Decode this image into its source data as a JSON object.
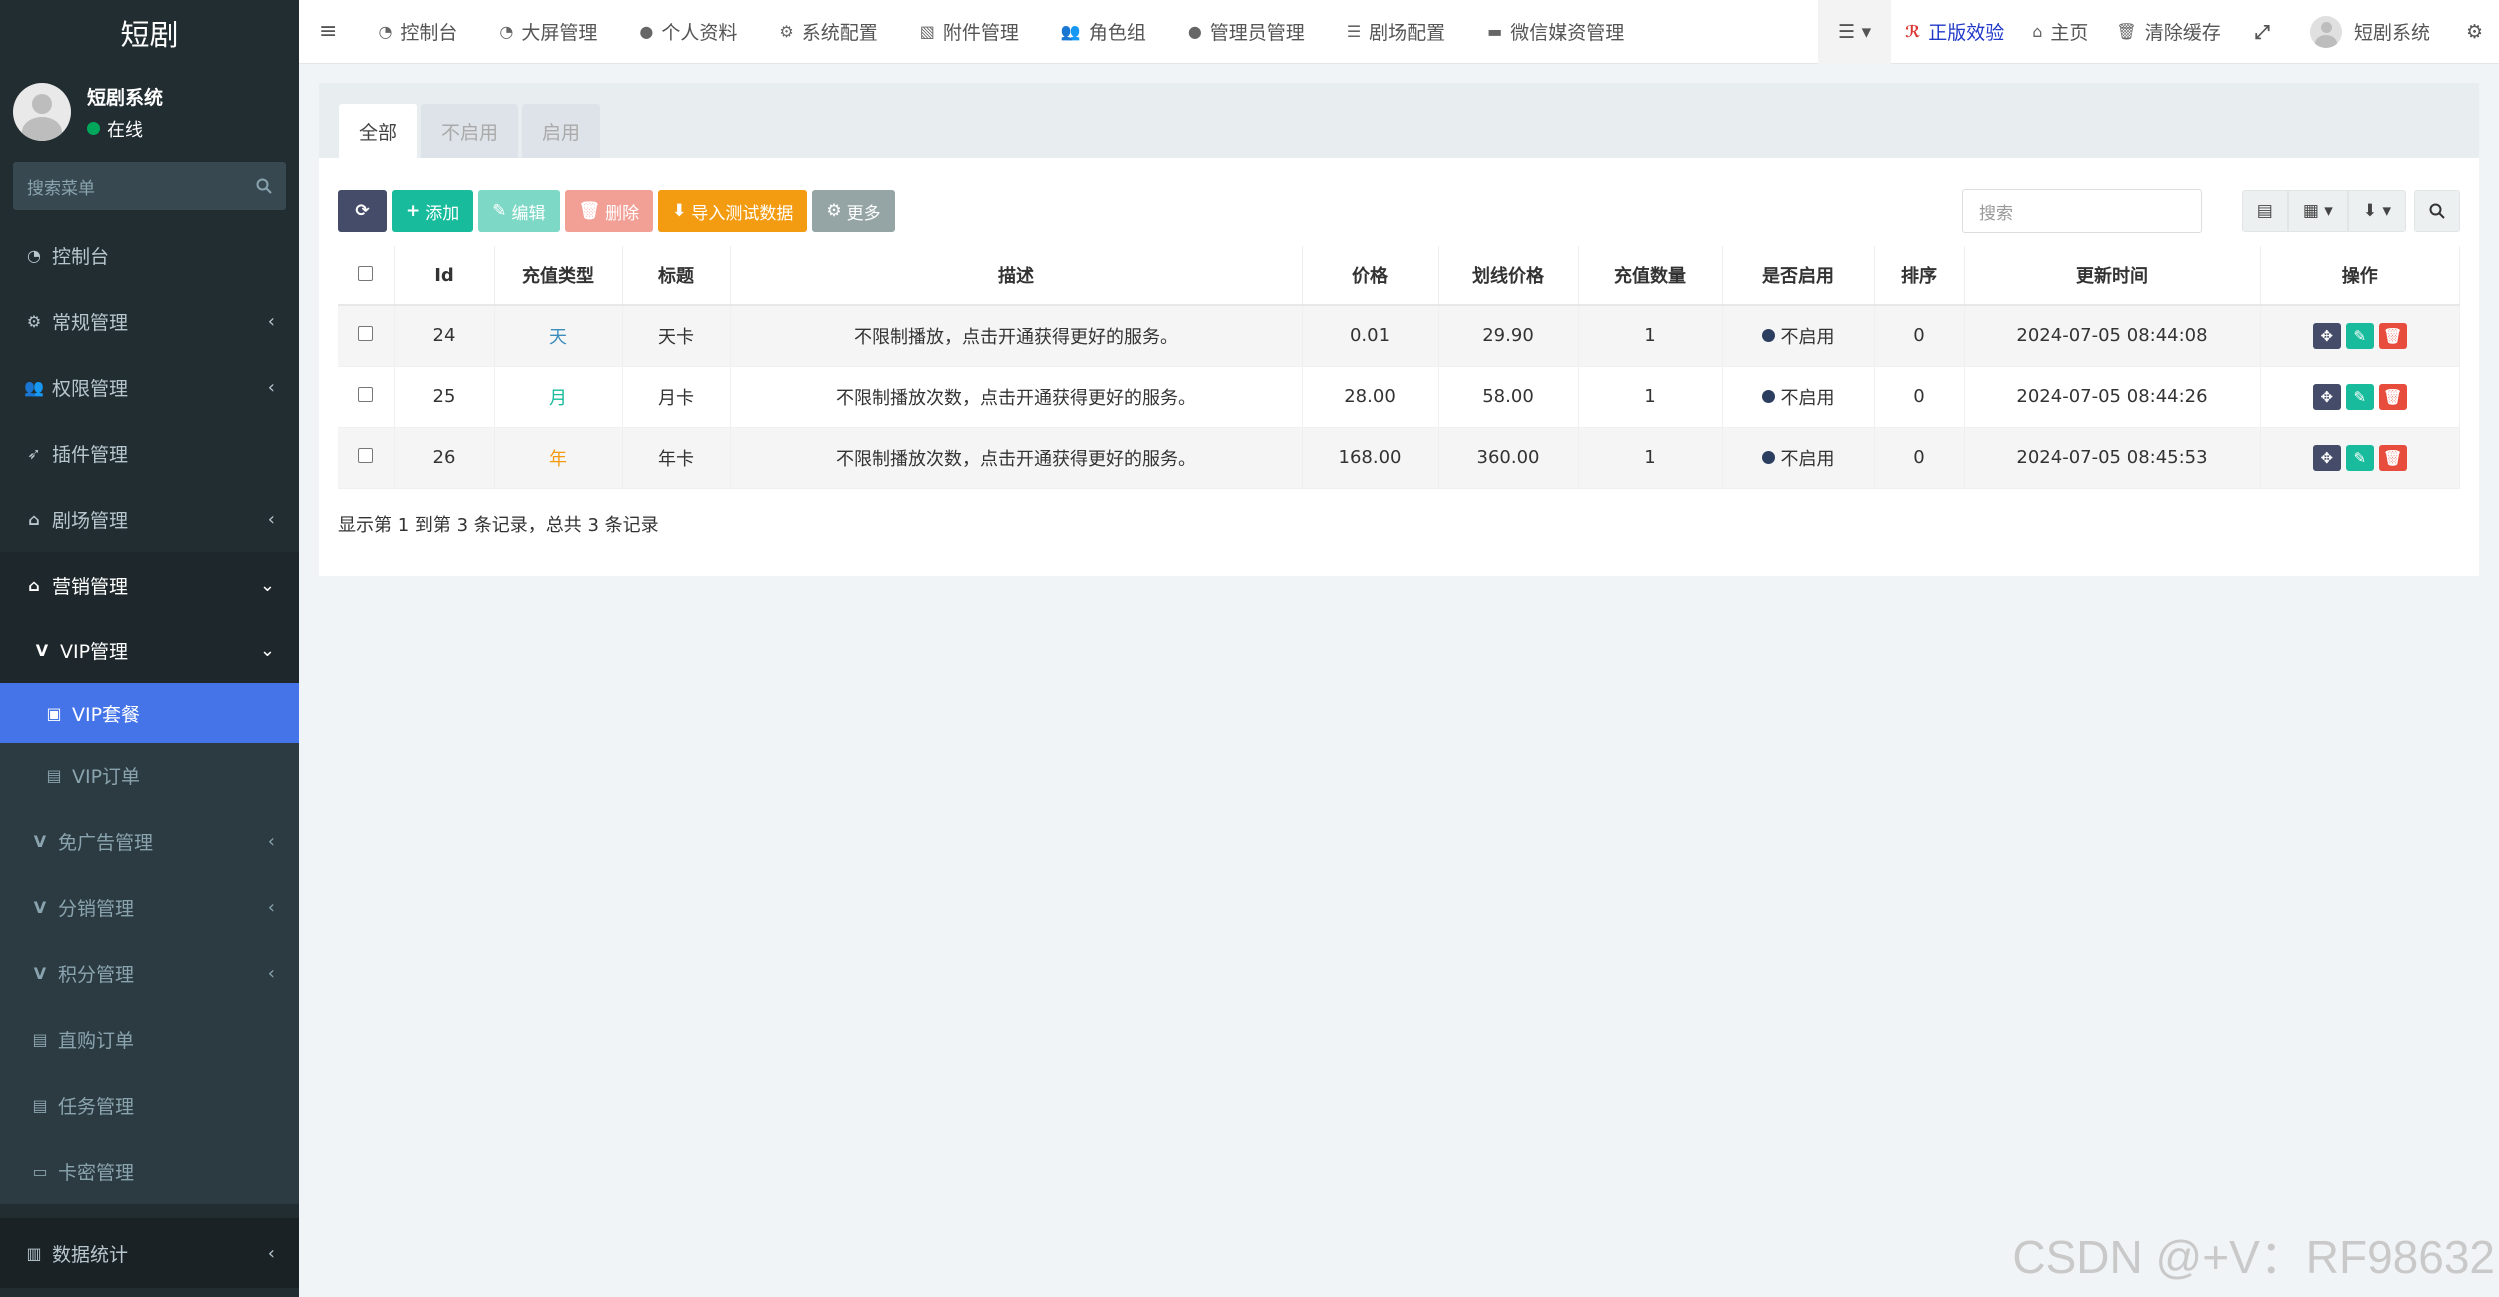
{
  "app": {
    "logo": "短剧"
  },
  "sidebar": {
    "user_name": "短剧系统",
    "user_status": "在线",
    "search_placeholder": "搜索菜单",
    "items": [
      {
        "label": "控制台",
        "icon": "dashboard-icon"
      },
      {
        "label": "常规管理",
        "icon": "cogs-icon"
      },
      {
        "label": "权限管理",
        "icon": "group-icon"
      },
      {
        "label": "插件管理",
        "icon": "rocket-icon"
      },
      {
        "label": "剧场管理",
        "icon": "home-icon"
      },
      {
        "label": "营销管理",
        "icon": "home-icon"
      },
      {
        "label": "VIP管理",
        "icon": "vimeo-icon"
      },
      {
        "label": "VIP套餐",
        "icon": "vimeo-square-icon"
      },
      {
        "label": "VIP订单",
        "icon": "file-icon"
      },
      {
        "label": "免广告管理",
        "icon": "vimeo-icon"
      },
      {
        "label": "分销管理",
        "icon": "vimeo-icon"
      },
      {
        "label": "积分管理",
        "icon": "vimeo-icon"
      },
      {
        "label": "直购订单",
        "icon": "file-icon"
      },
      {
        "label": "任务管理",
        "icon": "file-icon"
      },
      {
        "label": "卡密管理",
        "icon": "money-icon"
      },
      {
        "label": "数据统计",
        "icon": "bar-chart-icon"
      }
    ]
  },
  "topbar": {
    "nav": [
      {
        "label": "控制台",
        "icon": "dashboard-icon"
      },
      {
        "label": "大屏管理",
        "icon": "dashboard-icon"
      },
      {
        "label": "个人资料",
        "icon": "user-icon"
      },
      {
        "label": "系统配置",
        "icon": "cog-icon"
      },
      {
        "label": "附件管理",
        "icon": "file-image-icon"
      },
      {
        "label": "角色组",
        "icon": "group-icon"
      },
      {
        "label": "管理员管理",
        "icon": "user-icon"
      },
      {
        "label": "剧场配置",
        "icon": "sliders-icon"
      },
      {
        "label": "微信媒资管理",
        "icon": "briefcase-icon"
      }
    ],
    "right": {
      "verify": "正版效验",
      "home": "主页",
      "clear_cache": "清除缓存",
      "user": "短剧系统"
    }
  },
  "tabs": [
    "全部",
    "不启用",
    "启用"
  ],
  "toolbar": {
    "add": "添加",
    "edit": "编辑",
    "delete": "删除",
    "import": "导入测试数据",
    "more": "更多",
    "search_placeholder": "搜索"
  },
  "table": {
    "headers": [
      "Id",
      "充值类型",
      "标题",
      "描述",
      "价格",
      "划线价格",
      "充值数量",
      "是否启用",
      "排序",
      "更新时间",
      "操作"
    ],
    "rows": [
      {
        "id": "24",
        "type": "天",
        "title": "天卡",
        "desc": "不限制播放，点击开通获得更好的服务。",
        "price": "0.01",
        "orig_price": "29.90",
        "qty": "1",
        "status": "不启用",
        "sort": "0",
        "updated": "2024-07-05 08:44:08"
      },
      {
        "id": "25",
        "type": "月",
        "title": "月卡",
        "desc": "不限制播放次数，点击开通获得更好的服务。",
        "price": "28.00",
        "orig_price": "58.00",
        "qty": "1",
        "status": "不启用",
        "sort": "0",
        "updated": "2024-07-05 08:44:26"
      },
      {
        "id": "26",
        "type": "年",
        "title": "年卡",
        "desc": "不限制播放次数，点击开通获得更好的服务。",
        "price": "168.00",
        "orig_price": "360.00",
        "qty": "1",
        "status": "不启用",
        "sort": "0",
        "updated": "2024-07-05 08:45:53"
      }
    ]
  },
  "pager": "显示第 1 到第 3 条记录，总共 3 条记录",
  "watermark": "CSDN @+V：RF98632"
}
